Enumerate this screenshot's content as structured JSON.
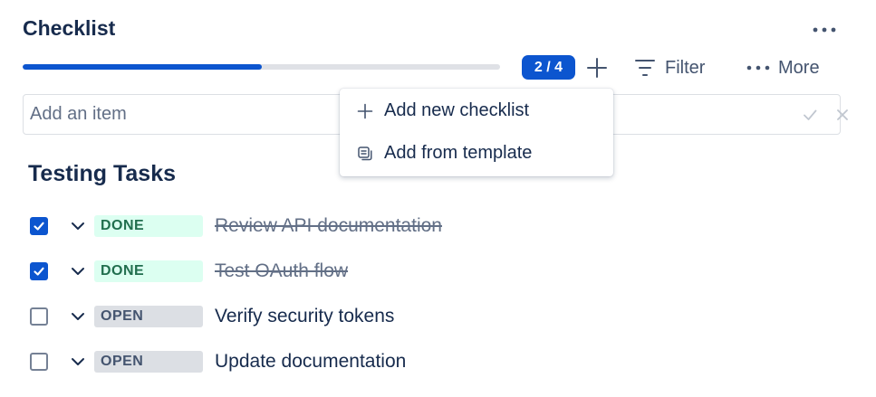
{
  "header": {
    "title": "Checklist",
    "more_actions_icon": "ellipsis-horizontal-icon"
  },
  "progress": {
    "completed": 2,
    "total": 4,
    "fraction": 0.5,
    "badge_label": "2 / 4",
    "fill_color": "#0c55cf",
    "track_color": "#dfe1e6"
  },
  "toolbar": {
    "add_icon": "plus-icon",
    "filter_icon": "filter-lines-icon",
    "filter_label": "Filter",
    "more_icon": "ellipsis-horizontal-icon",
    "more_label": "More"
  },
  "add_item": {
    "placeholder": "Add an item",
    "value": "",
    "confirm_icon": "check-icon",
    "cancel_icon": "close-icon"
  },
  "dropdown": {
    "items": [
      {
        "icon": "plus-icon",
        "label": "Add new checklist"
      },
      {
        "icon": "template-icon",
        "label": "Add from template"
      }
    ]
  },
  "checklist": {
    "title": "Testing Tasks",
    "tasks": [
      {
        "checked": true,
        "status": "DONE",
        "text": "Review API documentation"
      },
      {
        "checked": true,
        "status": "DONE",
        "text": "Test OAuth flow"
      },
      {
        "checked": false,
        "status": "OPEN",
        "text": "Verify security tokens"
      },
      {
        "checked": false,
        "status": "OPEN",
        "text": "Update documentation"
      }
    ]
  },
  "colors": {
    "primary": "#0c55cf",
    "done_bg": "#dcfff1",
    "done_text": "#216e4e",
    "open_bg": "#dcdfe4",
    "open_text": "#44546f",
    "text": "#172b4d"
  }
}
